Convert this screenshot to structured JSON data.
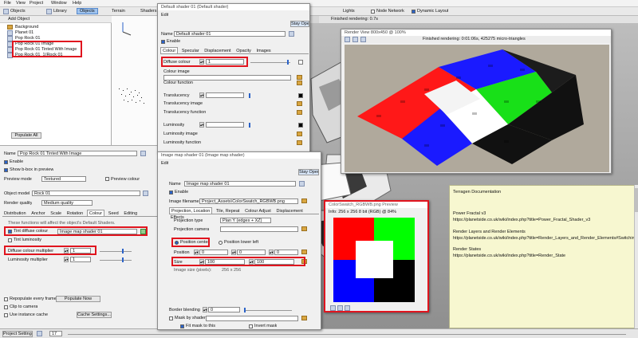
{
  "app": {
    "menu": [
      "File",
      "View",
      "Project",
      "Window",
      "Help"
    ],
    "toolbar": [
      "Objects",
      "Library",
      "Objects",
      "Terrain",
      "Shaders"
    ],
    "right_toolbar": [
      "Lights",
      "Node Network",
      "Dynamic Layout"
    ],
    "render_status": "Finished rendering: 0.7s"
  },
  "scene": {
    "add_object_label": "Add Object",
    "tree": [
      "Background",
      "Planet 01",
      "Pop Rock 01",
      "Pop Rock 01 Image",
      "Pop Rock 01 Tinted With Image",
      "Pop Rock 01_1(Rock 01"
    ],
    "populate_all": "Populate All"
  },
  "props": {
    "name_label": "Name",
    "name_value": "Pop Rock 01 Tinted With Image",
    "enable": "Enable",
    "show_bbox": "Show b-box in preview",
    "preview_mode_label": "Preview mode",
    "preview_mode_value": "Textured",
    "preview_colour": "Preview colour",
    "object_model_label": "Object model",
    "object_model_value": "Rock 01",
    "render_quality_label": "Render quality",
    "render_quality_value": "Medium quality",
    "tabs": [
      "Distribution",
      "Anchor",
      "Scale",
      "Rotation",
      "Colour",
      "Seed",
      "Editing"
    ],
    "note": "These functions will affect the object's Default Shaders.",
    "tint_diffuse": "Tint diffuse colour",
    "tint_diffuse_value": "Image map shader 01",
    "tint_luminosity": "Tint luminosity",
    "diffuse_mult_label": "Diffuse colour multiplier",
    "diffuse_mult_value": "1",
    "lum_mult_label": "Luminosity multiplier",
    "lum_mult_value": "1",
    "repopulate": "Repopulate every frame",
    "populate_now": "Populate Now",
    "clip_camera": "Clip to camera",
    "use_instance_cache": "Use instance cache",
    "cache_settings": "Cache Settings...",
    "project_settings": "Project Settings...",
    "frame": "17"
  },
  "default_shader": {
    "title": "Default shader 01   (Default shader)",
    "edit": "Edit",
    "stay_open": "Stay Open",
    "name_label": "Name",
    "name_value": "Default shader 01",
    "enable": "Enable",
    "tabs": [
      "Colour",
      "Specular",
      "Displacement",
      "Opacity",
      "Images"
    ],
    "diffuse_label": "Diffuse colour",
    "diffuse_value": "1",
    "rows": [
      "Colour image",
      "Colour function",
      "Translucency",
      "Translucency image",
      "Translucency function",
      "Luminosity",
      "Luminosity image",
      "Luminosity function"
    ]
  },
  "image_shader": {
    "title": "Image map shader 01   (Image map shader)",
    "edit": "Edit",
    "stay_open": "Stay Open",
    "name_label": "Name",
    "name_value": "Image map shader 01",
    "enable": "Enable",
    "filename_label": "Image filename",
    "filename_value": "Project_Assets\\ColorSwatch_RGBWB.png",
    "tabs": [
      "Projection, Location",
      "Tile, Repeat",
      "Colour Adjust",
      "Displacement",
      "Effects"
    ],
    "projection_type_label": "Projection type",
    "projection_type_value": "Plan Y (edges + XZ)",
    "projection_camera_label": "Projection camera",
    "pos_center": "Position center",
    "pos_lower_left": "Position lower left",
    "position_label": "Position",
    "position_values": [
      "0",
      "0",
      "0"
    ],
    "size_label": "Size",
    "size_values": [
      "100",
      "100"
    ],
    "image_size_label": "Image size (pixels):",
    "image_size_value": "256 x 256",
    "border_blending_label": "Border blending",
    "border_blending_value": "0",
    "mask_by_shader": "Mask by shader",
    "fit_mask": "Fit mask to this",
    "invert_mask": "Invert mask"
  },
  "render_view": {
    "title": "Render View 800x450 @ 100%",
    "status": "Finished rendering: 0:01:06s, 425275 micro-triangles"
  },
  "preview": {
    "title": "ColorSwatch_RGBWB.png Preview",
    "info": "Info: 256 x 256 8 bit (RGB) @ 84%"
  },
  "notes_panel": {
    "lines": [
      "Terragen Documentation",
      "Power Fractal v3",
      "https://planetside.co.uk/wiki/index.php?title=Power_Fractal_Shader_v3",
      "Render Layers and Render Elements",
      "https://planetside.co.uk/wiki/index.php?title=Render_Layers_and_Render_Elements#Switching_Between_R",
      "Render States",
      "https://planetside.co.uk/wiki/index.php?title=Render_State"
    ]
  },
  "colors": {
    "highlight": "#e0141e",
    "selection": "#3874d8",
    "red": "#ff0000",
    "green": "#00ff00",
    "blue": "#0000ff",
    "white": "#ffffff",
    "black": "#000000"
  }
}
